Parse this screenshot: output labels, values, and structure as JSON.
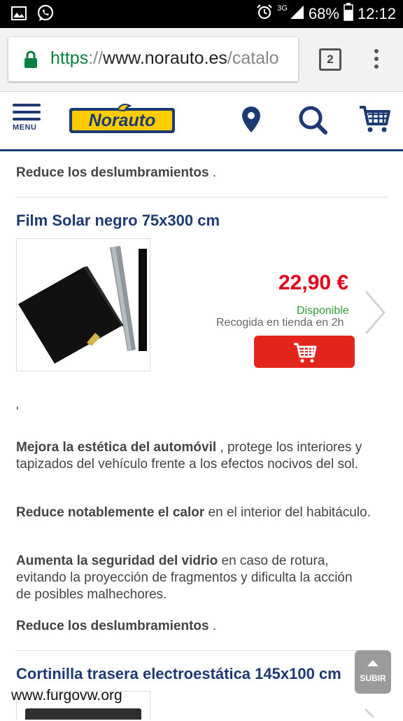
{
  "status_bar": {
    "network": "3G",
    "battery": "68%",
    "time": "12:12",
    "icons": [
      "image-icon",
      "whatsapp-icon",
      "alarm-icon",
      "signal-icon",
      "battery-icon"
    ]
  },
  "browser": {
    "url_scheme": "https",
    "url_sep": "://",
    "url_host": "www.norauto.es",
    "url_rest": "/catalo",
    "tab_count": "2",
    "accent": "#0b8043"
  },
  "site": {
    "menu_label": "MENU",
    "logo_text": "Norauto",
    "brand_color": "#1d3a73",
    "logo_yellow": "#ffcc00"
  },
  "content": {
    "top_note_strong": "Reduce los deslumbramientos",
    "top_note_end": " .",
    "product1": {
      "title": "Film Solar negro 75x300 cm",
      "price": "22,90 €",
      "availability": "Disponible",
      "pickup": "Recogida en tienda en 2h"
    },
    "stray_mark": "'",
    "features": [
      {
        "strong": "Mejora la estética del automóvil",
        "text": " , protege los interiores y tapizados del vehículo frente a los efectos nocivos del sol."
      },
      {
        "strong": "Reduce notablemente el calor",
        "text": " en el interior del habitáculo."
      },
      {
        "strong": "Aumenta la seguridad del vidrio",
        "text": " en caso de rotura, evitando la proyección de fragmentos y dificulta la acción de posibles malhechores."
      },
      {
        "strong": "Reduce los deslumbramientos",
        "text": " ."
      }
    ],
    "product2": {
      "title": "Cortinilla trasera electroestática 145x100 cm"
    }
  },
  "subir_label": "SUBIR",
  "watermark": "www.furgovw.org",
  "colors": {
    "price": "#e3001b",
    "available": "#2e9e3a",
    "cart_button": "#e3261c"
  }
}
